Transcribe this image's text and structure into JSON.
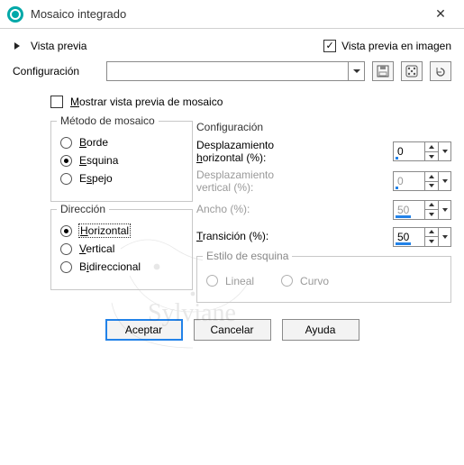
{
  "window": {
    "title": "Mosaico integrado"
  },
  "preview": {
    "toggle_label": "Vista previa",
    "on_image_label": "Vista previa en imagen",
    "on_image_checked": true
  },
  "config_bar": {
    "label": "Configuración",
    "value": ""
  },
  "show_preview": {
    "label": "Mostrar vista previa de mosaico",
    "checked": false
  },
  "method": {
    "legend": "Método de mosaico",
    "options": {
      "borde": "Borde",
      "esquina": "Esquina",
      "espejo": "Espejo"
    },
    "selected": "esquina"
  },
  "direction": {
    "legend": "Dirección",
    "options": {
      "horizontal": "Horizontal",
      "vertical": "Vertical",
      "bidireccional": "Bidireccional"
    },
    "selected": "horizontal"
  },
  "params": {
    "legend": "Configuración",
    "h_offset_label": "Desplazamiento horizontal (%):",
    "h_offset_value": "0",
    "h_offset_bar_pct": 8,
    "v_offset_label": "Desplazamiento vertical (%):",
    "v_offset_value": "0",
    "v_offset_bar_pct": 8,
    "width_label": "Ancho (%):",
    "width_value": "50",
    "width_bar_pct": 50,
    "transition_label": "Transición (%):",
    "transition_value": "50",
    "transition_bar_pct": 50
  },
  "corner_style": {
    "legend": "Estilo de esquina",
    "lineal": "Lineal",
    "curvo": "Curvo"
  },
  "buttons": {
    "ok": "Aceptar",
    "cancel": "Cancelar",
    "help": "Ayuda"
  }
}
